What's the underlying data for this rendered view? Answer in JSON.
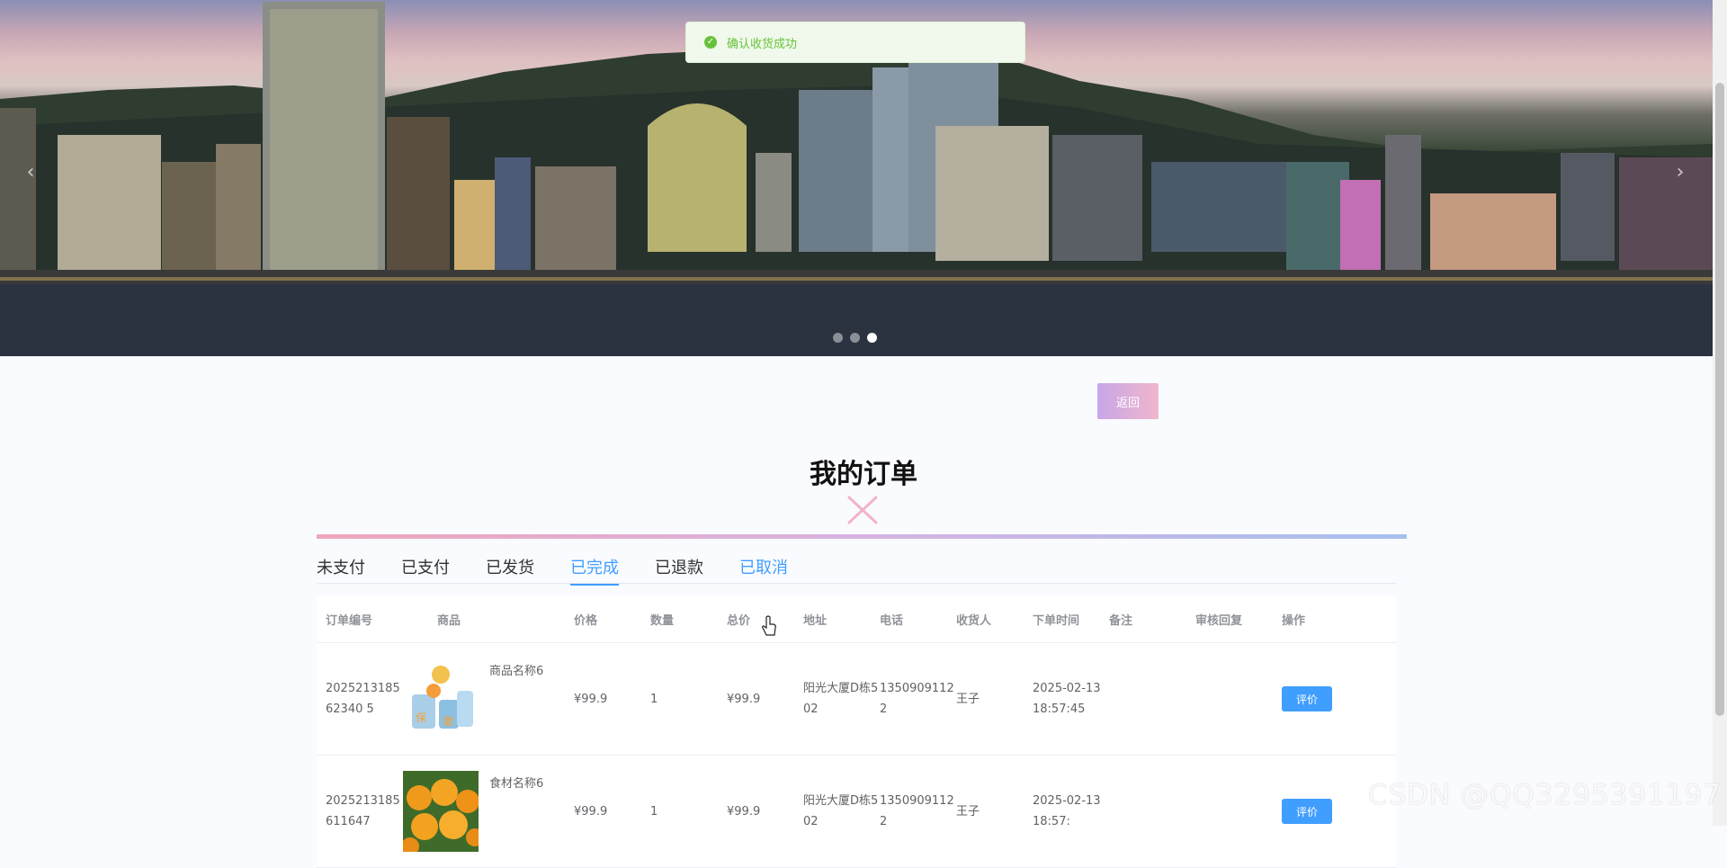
{
  "toast": {
    "text": "确认收货成功",
    "icon": "check-circle-icon",
    "color": "#67c23a"
  },
  "banner": {
    "prev_icon": "‹",
    "next_icon": "›",
    "slide_count": 3,
    "active_slide": 3
  },
  "back_button": {
    "label": "返回"
  },
  "page_title": "我的订单",
  "tabs": [
    {
      "label": "未支付"
    },
    {
      "label": "已支付"
    },
    {
      "label": "已发货"
    },
    {
      "label": "已完成"
    },
    {
      "label": "已退款"
    },
    {
      "label": "已取消"
    }
  ],
  "active_tab": "已完成",
  "table": {
    "headers": {
      "id": "订单编号",
      "goods": "商品",
      "price": "价格",
      "qty": "数量",
      "total": "总价",
      "address": "地址",
      "phone": "电话",
      "receiver": "收货人",
      "time": "下单时间",
      "note": "备注",
      "reply": "审核回复",
      "op": "操作"
    },
    "rows": [
      {
        "id": "202521318562340 5",
        "name": "商品名称6",
        "price": "¥99.9",
        "qty": "1",
        "total": "¥99.9",
        "address": "阳光大厦D栋502",
        "phone": "13509091122",
        "receiver": "王子",
        "time": "2025-02-13 18:57:45",
        "note": "",
        "reply": "",
        "action": "评价",
        "image": "health-product-image"
      },
      {
        "id": "2025213185611647",
        "name": "食材名称6",
        "price": "¥99.9",
        "qty": "1",
        "total": "¥99.9",
        "address": "阳光大厦D栋502",
        "phone": "13509091122",
        "receiver": "王子",
        "time": "2025-02-13 18:57:",
        "note": "",
        "reply": "",
        "action": "评价",
        "image": "oranges-image"
      }
    ]
  },
  "watermark": "CSDN @QQ3295391197",
  "colors": {
    "primary": "#409eff",
    "success": "#67c23a",
    "title_line_start": "#f0a7bd",
    "title_line_end": "#a6c0ef"
  }
}
